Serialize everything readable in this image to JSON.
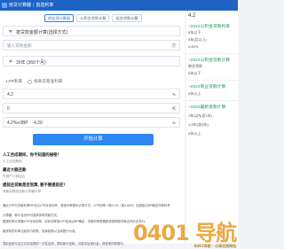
{
  "header": {
    "brand": "房贷计算器",
    "sep": "|",
    "site": "首选利率"
  },
  "tabs": [
    {
      "label": "商业贷计算器"
    },
    {
      "label": "公积金贷款计算"
    },
    {
      "label": "组合贷款计算"
    }
  ],
  "form": {
    "method": "按贷款金额计算(选择方式)",
    "amount_placeholder": "输入贷款金额",
    "amount_unit": "万",
    "term": "30年 (360个月)",
    "rate_options": [
      "LPR利率",
      "按商贷基准利率"
    ],
    "lpr_value": "4.2",
    "lpr_unit": "%",
    "bp_value": "0",
    "bp_unit": "点",
    "combined_label": "4.2%+0BP",
    "combined_value": "4.20",
    "combined_unit": "%"
  },
  "calc_button": "开始计算",
  "faq": [
    {
      "q": "人工合成期间，你不知道的秘密！",
      "a": "人工合成期间"
    },
    {
      "q": "最近大额还款",
      "a": "去资产计算结合"
    },
    {
      "q": "提前还贷款是否划算, 要不要提前还？",
      "a": "请使用提前还款计算器计算"
    }
  ],
  "paragraphs": [
    "通过LPR与贷款利率BP对比LPR浮动利率，基准利率按年计算方式，LPR利率一般4.2%（或4.65%）加减基点BP确定贷款利率",
    "计算器，和平台合作可选择多种贷款方式。",
    "根据利率计算器LPR浮动利率，实际利率按LPR加减点BP确定，贷款利率根据新规按照新贷款合同约定执行。",
    "新房商贷利率当前执行政策，具体政策以当地银行为准。",
    "提前还款与否方式包括提前一次性还清、提前部分还款，可能涉及违约金，请咨询贷款银行。"
  ],
  "sidebar": {
    "top_rate": "4.2",
    "heads": [
      "~2024公积金贷款利率",
      "~2024公积金贷款计算",
      "~2024商业贷款计算",
      "~2024最新贷款计算"
    ],
    "items": [
      "5年以下",
      "5年(及以上)",
      "2.85%",
      "商业贷款",
      "5年以下",
      "5年以上",
      "1年以内(含1年)",
      "1-5年(含5年)",
      "5年以上"
    ]
  },
  "watermark": {
    "text": "0401 导航",
    "sub": "0401导航 - 分享优质网站"
  },
  "colors": {
    "primary": "#2e86f0",
    "header": "#1e63c4",
    "accent": "#1f9a5a"
  }
}
